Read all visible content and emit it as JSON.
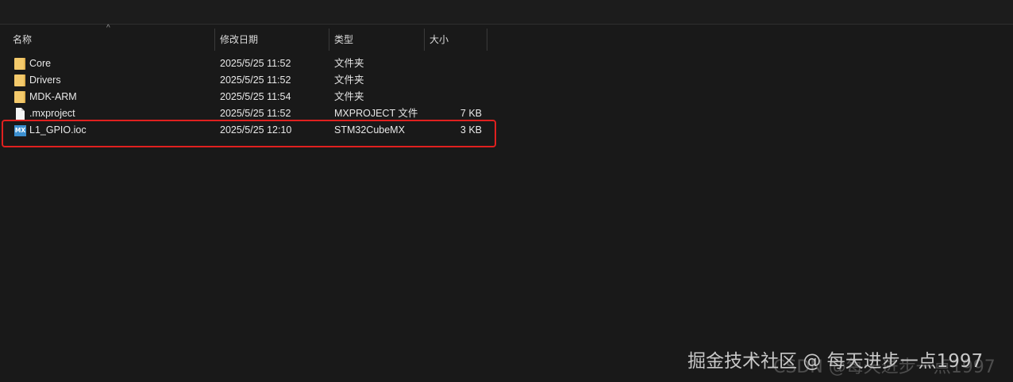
{
  "columns": {
    "name": "名称",
    "date": "修改日期",
    "type": "类型",
    "size": "大小"
  },
  "files": [
    {
      "icon": "folder-icon",
      "name": "Core",
      "date": "2025/5/25 11:52",
      "type": "文件夹",
      "size": ""
    },
    {
      "icon": "folder-icon",
      "name": "Drivers",
      "date": "2025/5/25 11:52",
      "type": "文件夹",
      "size": ""
    },
    {
      "icon": "folder-icon",
      "name": "MDK-ARM",
      "date": "2025/5/25 11:54",
      "type": "文件夹",
      "size": ""
    },
    {
      "icon": "file-icon",
      "name": ".mxproject",
      "date": "2025/5/25 11:52",
      "type": "MXPROJECT 文件",
      "size": "7 KB"
    },
    {
      "icon": "stm32cubemx-icon",
      "name": "L1_GPIO.ioc",
      "date": "2025/5/25 12:10",
      "type": "STM32CubeMX",
      "size": "3 KB"
    }
  ],
  "mx_icon_text": "MX",
  "colors": {
    "background": "#191919",
    "highlight": "#e0201f",
    "folder": "#f3c96b",
    "mx_icon": "#3b8fd0"
  },
  "watermark": {
    "front": "掘金技术社区 @ 每天进步一点1997",
    "back": "CSDN @每天进步一点1997"
  }
}
